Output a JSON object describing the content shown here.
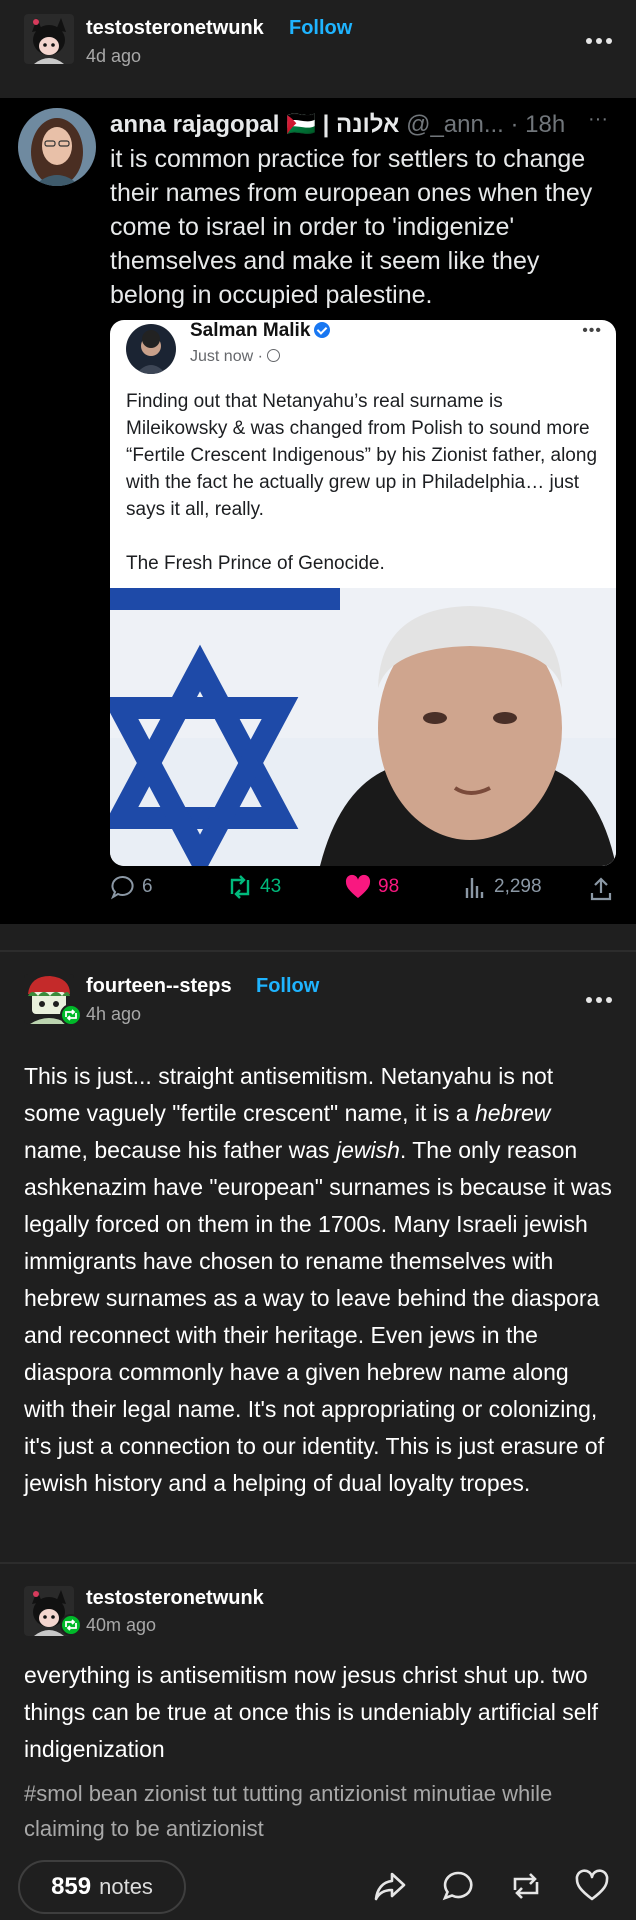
{
  "colors": {
    "background": "#1f1f1f",
    "follow_blue": "#1fb4ff",
    "reblog_green": "#00b929",
    "like_pink": "#f91880",
    "retweet_green": "#00ba7c",
    "tweet_bg": "#000000"
  },
  "op_post": {
    "username": "testosteronetwunk",
    "follow_label": "Follow",
    "time": "4d ago",
    "menu_icon": "more-dots-icon"
  },
  "tweet": {
    "author_name": "anna rajagopal 🇵🇸 | אלונה",
    "handle_time": "@_ann... · 18h",
    "more": "···",
    "text": "it is common practice for settlers to change their names from european ones when they come to israel in order to 'indigenize' themselves and make it seem like they belong in occupied palestine.",
    "quoted": {
      "name": "Salman Malik",
      "time": "Just now · ",
      "text_1": "Finding out that Netanyahu’s real surname is Mileikowsky & was changed from Polish to sound more “Fertile Crescent Indigenous” by his Zionist father, along with the fact he actually grew up in Philadelphia… just says it all, really.",
      "text_2": "The Fresh Prince of Genocide."
    },
    "stats": {
      "replies": "6",
      "retweets": "43",
      "likes": "98",
      "views": "2,298"
    }
  },
  "reply_1": {
    "username": "fourteen--steps",
    "follow_label": "Follow",
    "time": "4h ago",
    "text_a": "This is just... straight antisemitism. Netanyahu is not some vaguely \"fertile crescent\" name, it is a ",
    "text_em1": "hebrew",
    "text_b": " name, because his father was ",
    "text_em2": "jewish",
    "text_c": ". The only reason ashkenazim have \"european\" surnames is because it was legally forced on them in the 1700s. Many Israeli jewish immigrants have chosen to rename themselves with hebrew surnames as a way to leave behind the diaspora and reconnect with their heritage. Even jews in the diaspora commonly have a given hebrew name along with their legal name. It's not appropriating or colonizing, it's just a connection to our identity. This is just erasure of jewish history and a helping of dual loyalty tropes."
  },
  "reply_2": {
    "username": "testosteronetwunk",
    "time": "40m ago",
    "text": "everything is antisemitism now jesus christ shut up. two things can be true at once this is undeniably artificial self indigenization",
    "tags": "#smol bean zionist tut tutting antizionist minutiae while claiming to be antizionist"
  },
  "footer": {
    "notes_count": "859",
    "notes_label": "notes",
    "icons": [
      "share-icon",
      "reply-icon",
      "reblog-icon",
      "like-icon"
    ]
  }
}
